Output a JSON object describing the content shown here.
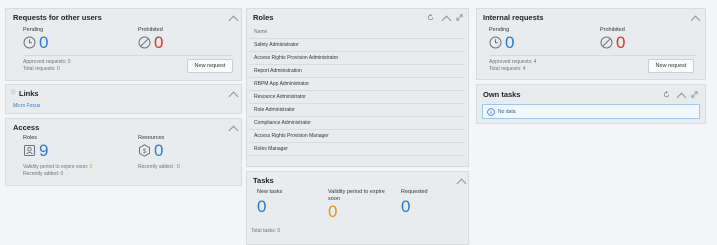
{
  "requests_panel": {
    "title": "Requests for other users",
    "pending_label": "Pending",
    "pending_value": "0",
    "prohibited_label": "Prohibited",
    "prohibited_value": "0",
    "approved_text": "Approved requests: 0",
    "total_text": "Total requests: 0",
    "new_request_label": "New request"
  },
  "links_panel": {
    "title": "Links",
    "link_text": "Micro Focus"
  },
  "access_panel": {
    "title": "Access",
    "roles_label": "Roles",
    "roles_value": "9",
    "resources_label": "Resources",
    "resources_value": "0",
    "validity_text": "Validity period to expire soon: ",
    "validity_count": "0",
    "recently_added_roles": "Recently added: 0",
    "recently_added_resources": "Recently added : 0"
  },
  "roles_panel": {
    "title": "Roles",
    "column_header": "Name",
    "items": [
      "Safety Administrator",
      "Access Rights Provision Administrator",
      "Report Administration",
      "RBPM App Administrator",
      "Resource Administrator",
      "Role Administrator",
      "Compliance Administrator",
      "Access Rights Provision Manager",
      "Roles Manager"
    ]
  },
  "tasks_panel": {
    "title": "Tasks",
    "new_tasks_label": "New tasks",
    "new_tasks_value": "0",
    "validity_label": "Validity period to expire soon",
    "validity_value": "0",
    "requested_label": "Requested",
    "requested_value": "0",
    "total_text": "Total tasks: 0"
  },
  "internal_panel": {
    "title": "Internal requests",
    "pending_label": "Pending",
    "pending_value": "0",
    "prohibited_label": "Prohibited",
    "prohibited_value": "0",
    "approved_text": "Approved requests: 4",
    "total_text": "Total requests: 4",
    "new_request_label": "New request"
  },
  "own_tasks_panel": {
    "title": "Own tasks",
    "no_data_text": "No data"
  },
  "colors": {
    "accent_blue": "#2a7bd3",
    "alert_red": "#e0302a",
    "warning_orange": "#e8901e"
  },
  "icons": [
    "clock-icon",
    "prohibited-icon",
    "star-icon",
    "roles-icon",
    "resources-icon",
    "refresh-icon",
    "collapse-icon",
    "expand-icon",
    "info-icon"
  ]
}
